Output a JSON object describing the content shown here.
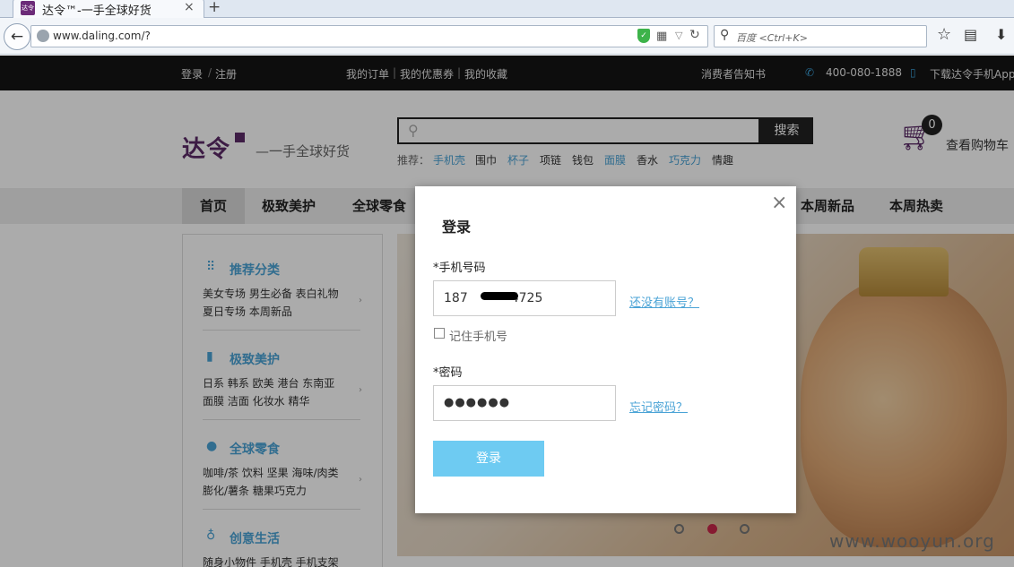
{
  "browser": {
    "tab_icon_text": "达令",
    "tab_title": "达令™-一手全球好货",
    "tab_close": "×",
    "new_tab": "+",
    "back": "←",
    "url": "www.daling.com/?",
    "search_placeholder": "百度 <Ctrl+K>",
    "icons": [
      "back-arrow-icon",
      "globe-icon",
      "shield-icon",
      "qr-code-icon",
      "dropdown-icon",
      "reload-icon",
      "search-icon",
      "star-icon",
      "reader-icon",
      "download-icon"
    ]
  },
  "topbar": {
    "login": "登录",
    "sep": "/",
    "register": "注册",
    "my_orders": "我的订单",
    "my_coupons": "我的优惠券",
    "my_favorites": "我的收藏",
    "pipe": "|",
    "consumer_notice": "消费者告知书",
    "hotline": "400-080-1888",
    "download_app": "下载达令手机App"
  },
  "header": {
    "logo": "达令",
    "slogan": "一手全球好货",
    "search_button": "搜索",
    "hot_label": "推荐：",
    "hot_words": [
      {
        "text": "手机壳",
        "highlight": true
      },
      {
        "text": "围巾",
        "highlight": false
      },
      {
        "text": "杯子",
        "highlight": true
      },
      {
        "text": "项链",
        "highlight": false
      },
      {
        "text": "钱包",
        "highlight": false
      },
      {
        "text": "面膜",
        "highlight": true
      },
      {
        "text": "香水",
        "highlight": false
      },
      {
        "text": "巧克力",
        "highlight": true
      },
      {
        "text": "情趣",
        "highlight": false
      }
    ],
    "cart_count": "0",
    "cart_label": "查看购物车"
  },
  "nav": {
    "items": [
      "首页",
      "极致美护",
      "全球零食",
      "本周新品",
      "本周热卖"
    ]
  },
  "sidebar": {
    "sections": [
      {
        "title": "推荐分类",
        "line1": "美女专场  男生必备  表白礼物",
        "line2": "夏日专场  本周新品"
      },
      {
        "title": "极致美护",
        "line1": "日系  韩系  欧美  港台  东南亚",
        "line2": "面膜  洁面  化妆水  精华"
      },
      {
        "title": "全球零食",
        "line1": "咖啡/茶  饮料  坚果  海味/肉类",
        "line2": "膨化/薯条  糖果巧克力"
      },
      {
        "title": "创意生活",
        "line1": "随身小物件  手机壳  手机支架",
        "line2": ""
      }
    ],
    "arrow": "›"
  },
  "banner": {
    "active_dot": 1,
    "dot_count": 3,
    "watermark": "www.wooyun.org"
  },
  "modal": {
    "close": "×",
    "title": "登录",
    "phone_label": "*手机号码",
    "phone_value": "187",
    "phone_value_tail": "4725",
    "no_account_link": "还没有账号？",
    "remember_label": "记住手机号",
    "password_label": "*密码",
    "password_value": "●●●●●●",
    "forgot_link": "忘记密码？",
    "login_button": "登录"
  },
  "colors": {
    "brand": "#5b2a67",
    "accent_blue": "#4aa3d6",
    "login_button": "#6ecbf2",
    "carousel_active": "#c8284a"
  }
}
